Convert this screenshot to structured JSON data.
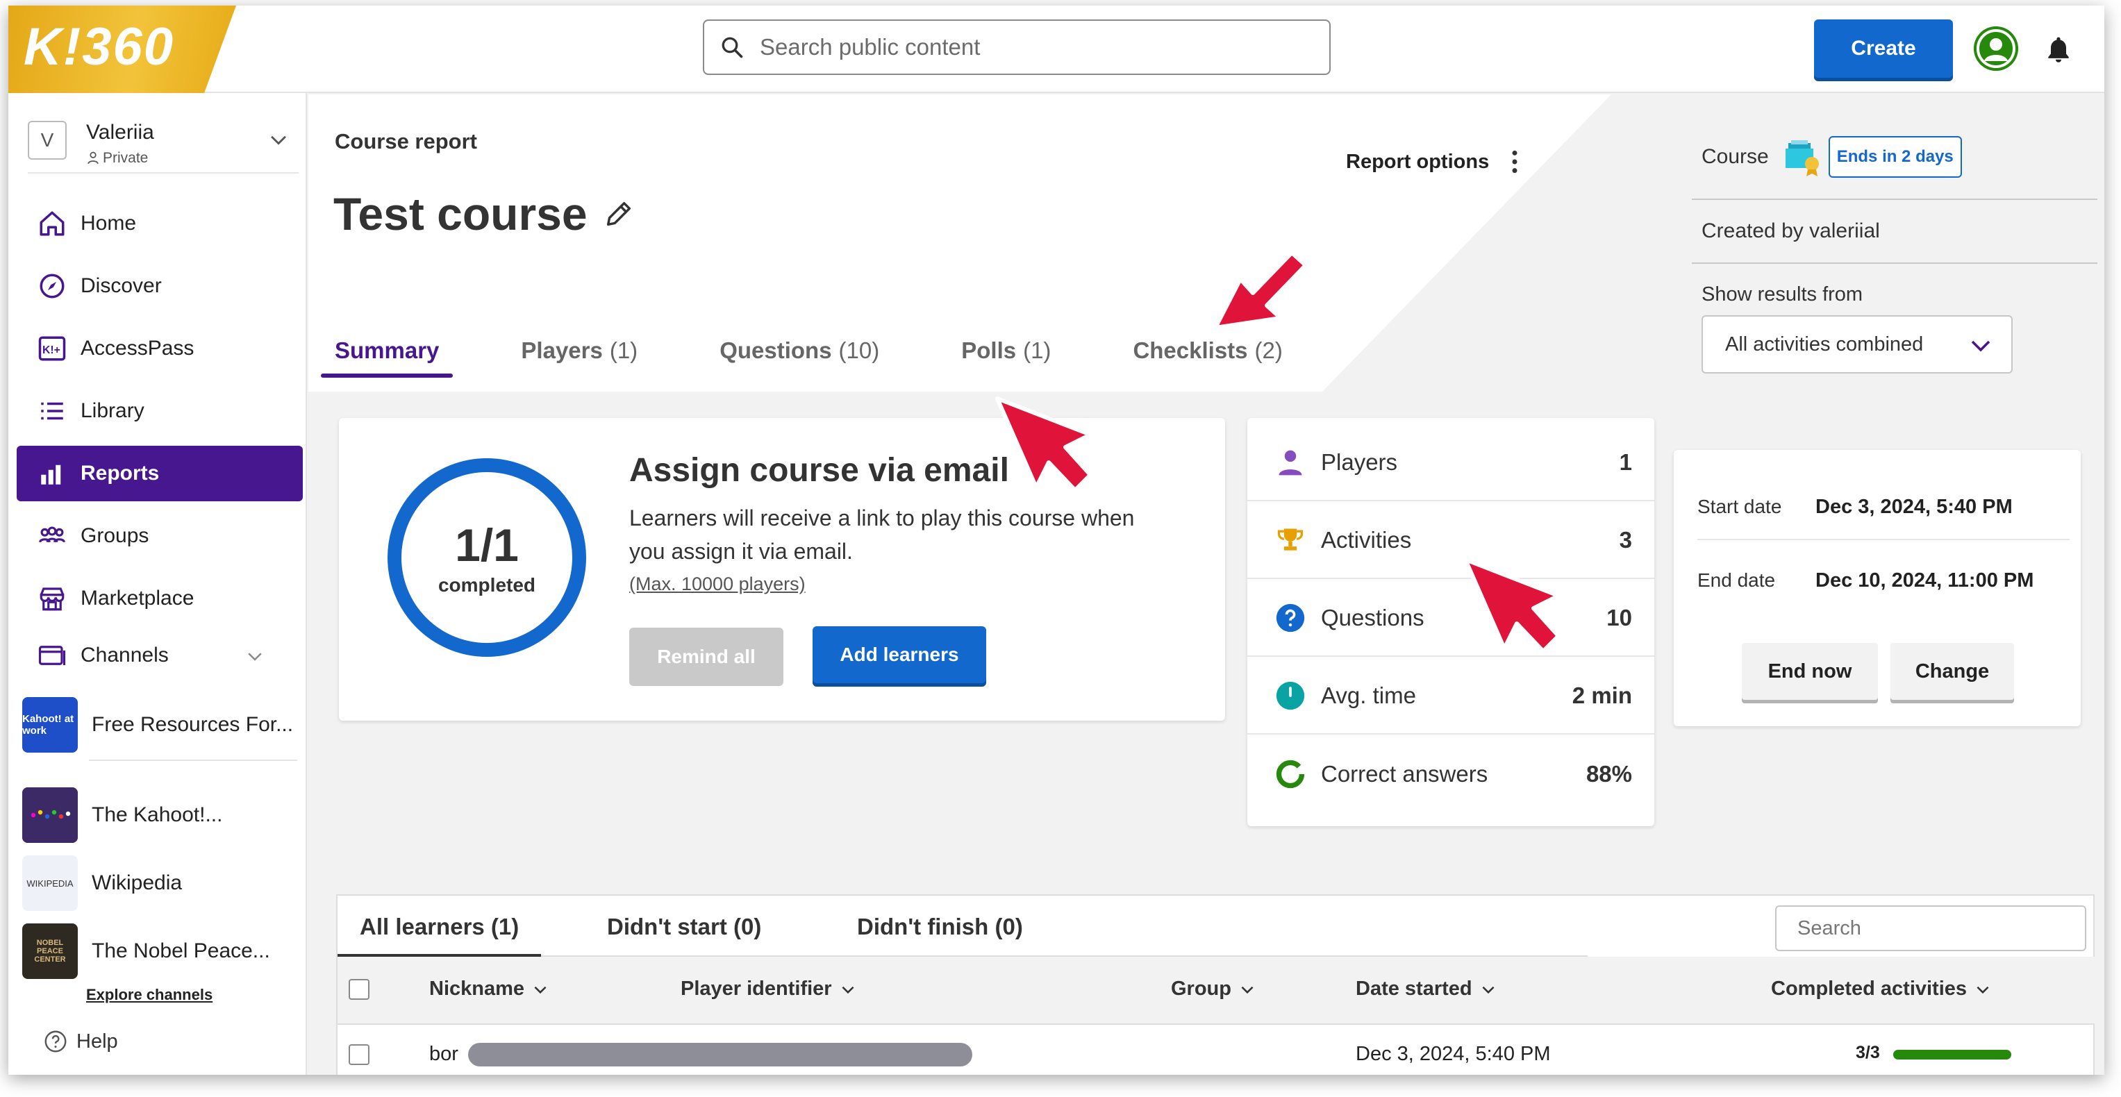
{
  "app": {
    "logo_text": "K!360",
    "search_placeholder": "Search public content",
    "create_label": "Create"
  },
  "workspace": {
    "initial": "V",
    "name": "Valeriia",
    "visibility": "Private"
  },
  "nav": [
    {
      "label": "Home",
      "icon": "home-icon"
    },
    {
      "label": "Discover",
      "icon": "compass-icon"
    },
    {
      "label": "AccessPass",
      "icon": "accesspass-icon"
    },
    {
      "label": "Library",
      "icon": "list-icon"
    },
    {
      "label": "Reports",
      "icon": "bar-chart-icon",
      "active": true
    },
    {
      "label": "Groups",
      "icon": "groups-icon"
    },
    {
      "label": "Marketplace",
      "icon": "store-icon"
    },
    {
      "label": "Channels",
      "icon": "channels-icon"
    }
  ],
  "channels": [
    {
      "label": "Free Resources For...",
      "thumb": "Kahoot! at work"
    },
    {
      "label": "The Kahoot!..."
    },
    {
      "label": "Wikipedia",
      "thumb": "WIKIPEDIA"
    },
    {
      "label": "The Nobel Peace...",
      "thumb": "NOBEL PEACE CENTER"
    }
  ],
  "explore_label": "Explore channels",
  "help_label": "Help",
  "report": {
    "section_label": "Course report",
    "title": "Test course",
    "options_label": "Report options",
    "tabs": [
      {
        "label": "Summary",
        "count": ""
      },
      {
        "label": "Players",
        "count": "(1)"
      },
      {
        "label": "Questions",
        "count": "(10)"
      },
      {
        "label": "Polls",
        "count": "(1)"
      },
      {
        "label": "Checklists",
        "count": "(2)"
      }
    ]
  },
  "info": {
    "course_label": "Course",
    "ends_badge": "Ends in 2 days",
    "created_by": "Created by valeriial",
    "show_results_label": "Show results from",
    "show_results_value": "All activities combined"
  },
  "assign": {
    "completion": "1/1",
    "completion_label": "completed",
    "heading": "Assign course via email",
    "description": "Learners will receive a link to play this course when you assign it via email.",
    "max_note": "(Max. 10000 players)",
    "remind_label": "Remind all",
    "add_label": "Add learners"
  },
  "stats": [
    {
      "label": "Players",
      "value": "1",
      "icon": "person-icon",
      "color": "#864cbf"
    },
    {
      "label": "Activities",
      "value": "3",
      "icon": "trophy-icon",
      "color": "#e6a000"
    },
    {
      "label": "Questions",
      "value": "10",
      "icon": "question-icon",
      "color": "#1368ce"
    },
    {
      "label": "Avg. time",
      "value": "2 min",
      "icon": "clock-icon",
      "color": "#0aa3a3"
    },
    {
      "label": "Correct answers",
      "value": "88%",
      "icon": "ring-icon",
      "color": "#26890c"
    }
  ],
  "dates": {
    "start_label": "Start date",
    "start_value": "Dec 3, 2024, 5:40 PM",
    "end_label": "End date",
    "end_value": "Dec 10, 2024, 11:00 PM",
    "end_now_label": "End now",
    "change_label": "Change"
  },
  "learners": {
    "tabs": [
      "All learners (1)",
      "Didn't start (0)",
      "Didn't finish (0)"
    ],
    "search_placeholder": "Search",
    "columns": [
      "Nickname",
      "Player identifier",
      "Group",
      "Date started",
      "Completed activities"
    ],
    "rows": [
      {
        "nickname": "bor",
        "date_started": "Dec 3, 2024, 5:40 PM",
        "completed": "3/3",
        "progress": 1.0
      }
    ]
  },
  "colors": {
    "brand_purple": "#46178f",
    "brand_blue": "#1368ce",
    "logo_gold": "#e4a817",
    "success_green": "#26890c"
  }
}
